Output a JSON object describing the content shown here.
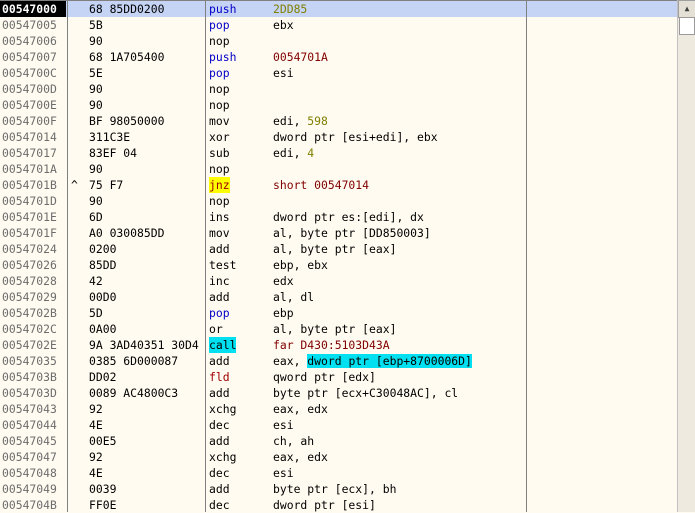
{
  "rows": [
    {
      "addr": "00547000",
      "hex": "68 85DD0200",
      "mn": "push",
      "op": "2DD85",
      "sel": true,
      "mnc": "c-blue",
      "opc": "c-olive"
    },
    {
      "addr": "00547005",
      "hex": "5B",
      "mn": "pop",
      "op": "ebx",
      "mnc": "c-blue"
    },
    {
      "addr": "00547006",
      "hex": "90",
      "mn": "nop",
      "op": ""
    },
    {
      "addr": "00547007",
      "hex": "68 1A705400",
      "mn": "push",
      "op": "0054701A",
      "mnc": "c-blue",
      "opc": "c-maroon"
    },
    {
      "addr": "0054700C",
      "hex": "5E",
      "mn": "pop",
      "op": "esi",
      "mnc": "c-blue"
    },
    {
      "addr": "0054700D",
      "hex": "90",
      "mn": "nop",
      "op": ""
    },
    {
      "addr": "0054700E",
      "hex": "90",
      "mn": "nop",
      "op": ""
    },
    {
      "addr": "0054700F",
      "hex": "BF 98050000",
      "mn": "mov",
      "op": "edi, ",
      "num": "598"
    },
    {
      "addr": "00547014",
      "hex": "311C3E",
      "mn": "xor",
      "op": "dword ptr [esi+edi], ebx"
    },
    {
      "addr": "00547017",
      "hex": "83EF 04",
      "mn": "sub",
      "op": "edi, ",
      "num": "4"
    },
    {
      "addr": "0054701A",
      "hex": "90",
      "mn": "nop",
      "op": ""
    },
    {
      "addr": "0054701B",
      "mark": "^",
      "hex": "75 F7",
      "mn": "jnz",
      "op": "short 00547014",
      "mnc": "hl-yellow",
      "opc": "c-maroon"
    },
    {
      "addr": "0054701D",
      "hex": "90",
      "mn": "nop",
      "op": ""
    },
    {
      "addr": "0054701E",
      "hex": "6D",
      "mn": "ins",
      "op": "dword ptr es:[edi], dx"
    },
    {
      "addr": "0054701F",
      "hex": "A0 030085DD",
      "mn": "mov",
      "op": "al, byte ptr [DD850003]"
    },
    {
      "addr": "00547024",
      "hex": "0200",
      "mn": "add",
      "op": "al, byte ptr [eax]"
    },
    {
      "addr": "00547026",
      "hex": "85DD",
      "mn": "test",
      "op": "ebp, ebx"
    },
    {
      "addr": "00547028",
      "hex": "42",
      "mn": "inc",
      "op": "edx"
    },
    {
      "addr": "00547029",
      "hex": "00D0",
      "mn": "add",
      "op": "al, dl"
    },
    {
      "addr": "0054702B",
      "hex": "5D",
      "mn": "pop",
      "op": "ebp",
      "mnc": "c-blue"
    },
    {
      "addr": "0054702C",
      "hex": "0A00",
      "mn": "or",
      "op": "al, byte ptr [eax]"
    },
    {
      "addr": "0054702E",
      "hex": "9A 3AD40351 30D4",
      "mn": "call",
      "op": "far D430:5103D43A",
      "mnc": "hl-cyan",
      "opc": "c-maroon"
    },
    {
      "addr": "00547035",
      "hex": "0385 6D000087",
      "mn": "add",
      "op_pre": "eax, ",
      "op_hl": "dword ptr [ebp+8700006D]"
    },
    {
      "addr": "0054703B",
      "hex": "DD02",
      "mn": "fld",
      "op": "qword ptr [edx]",
      "mnc": "c-red"
    },
    {
      "addr": "0054703D",
      "hex": "0089 AC4800C3",
      "mn": "add",
      "op": "byte ptr [ecx+C30048AC], cl"
    },
    {
      "addr": "00547043",
      "hex": "92",
      "mn": "xchg",
      "op": "eax, edx"
    },
    {
      "addr": "00547044",
      "hex": "4E",
      "mn": "dec",
      "op": "esi"
    },
    {
      "addr": "00547045",
      "hex": "00E5",
      "mn": "add",
      "op": "ch, ah"
    },
    {
      "addr": "00547047",
      "hex": "92",
      "mn": "xchg",
      "op": "eax, edx"
    },
    {
      "addr": "00547048",
      "hex": "4E",
      "mn": "dec",
      "op": "esi"
    },
    {
      "addr": "00547049",
      "hex": "0039",
      "mn": "add",
      "op": "byte ptr [ecx], bh"
    },
    {
      "addr": "0054704B",
      "hex": "FF0E",
      "mn": "dec",
      "op": "dword ptr [esi]"
    }
  ],
  "scrollbar": {
    "up_icon": "▲"
  }
}
